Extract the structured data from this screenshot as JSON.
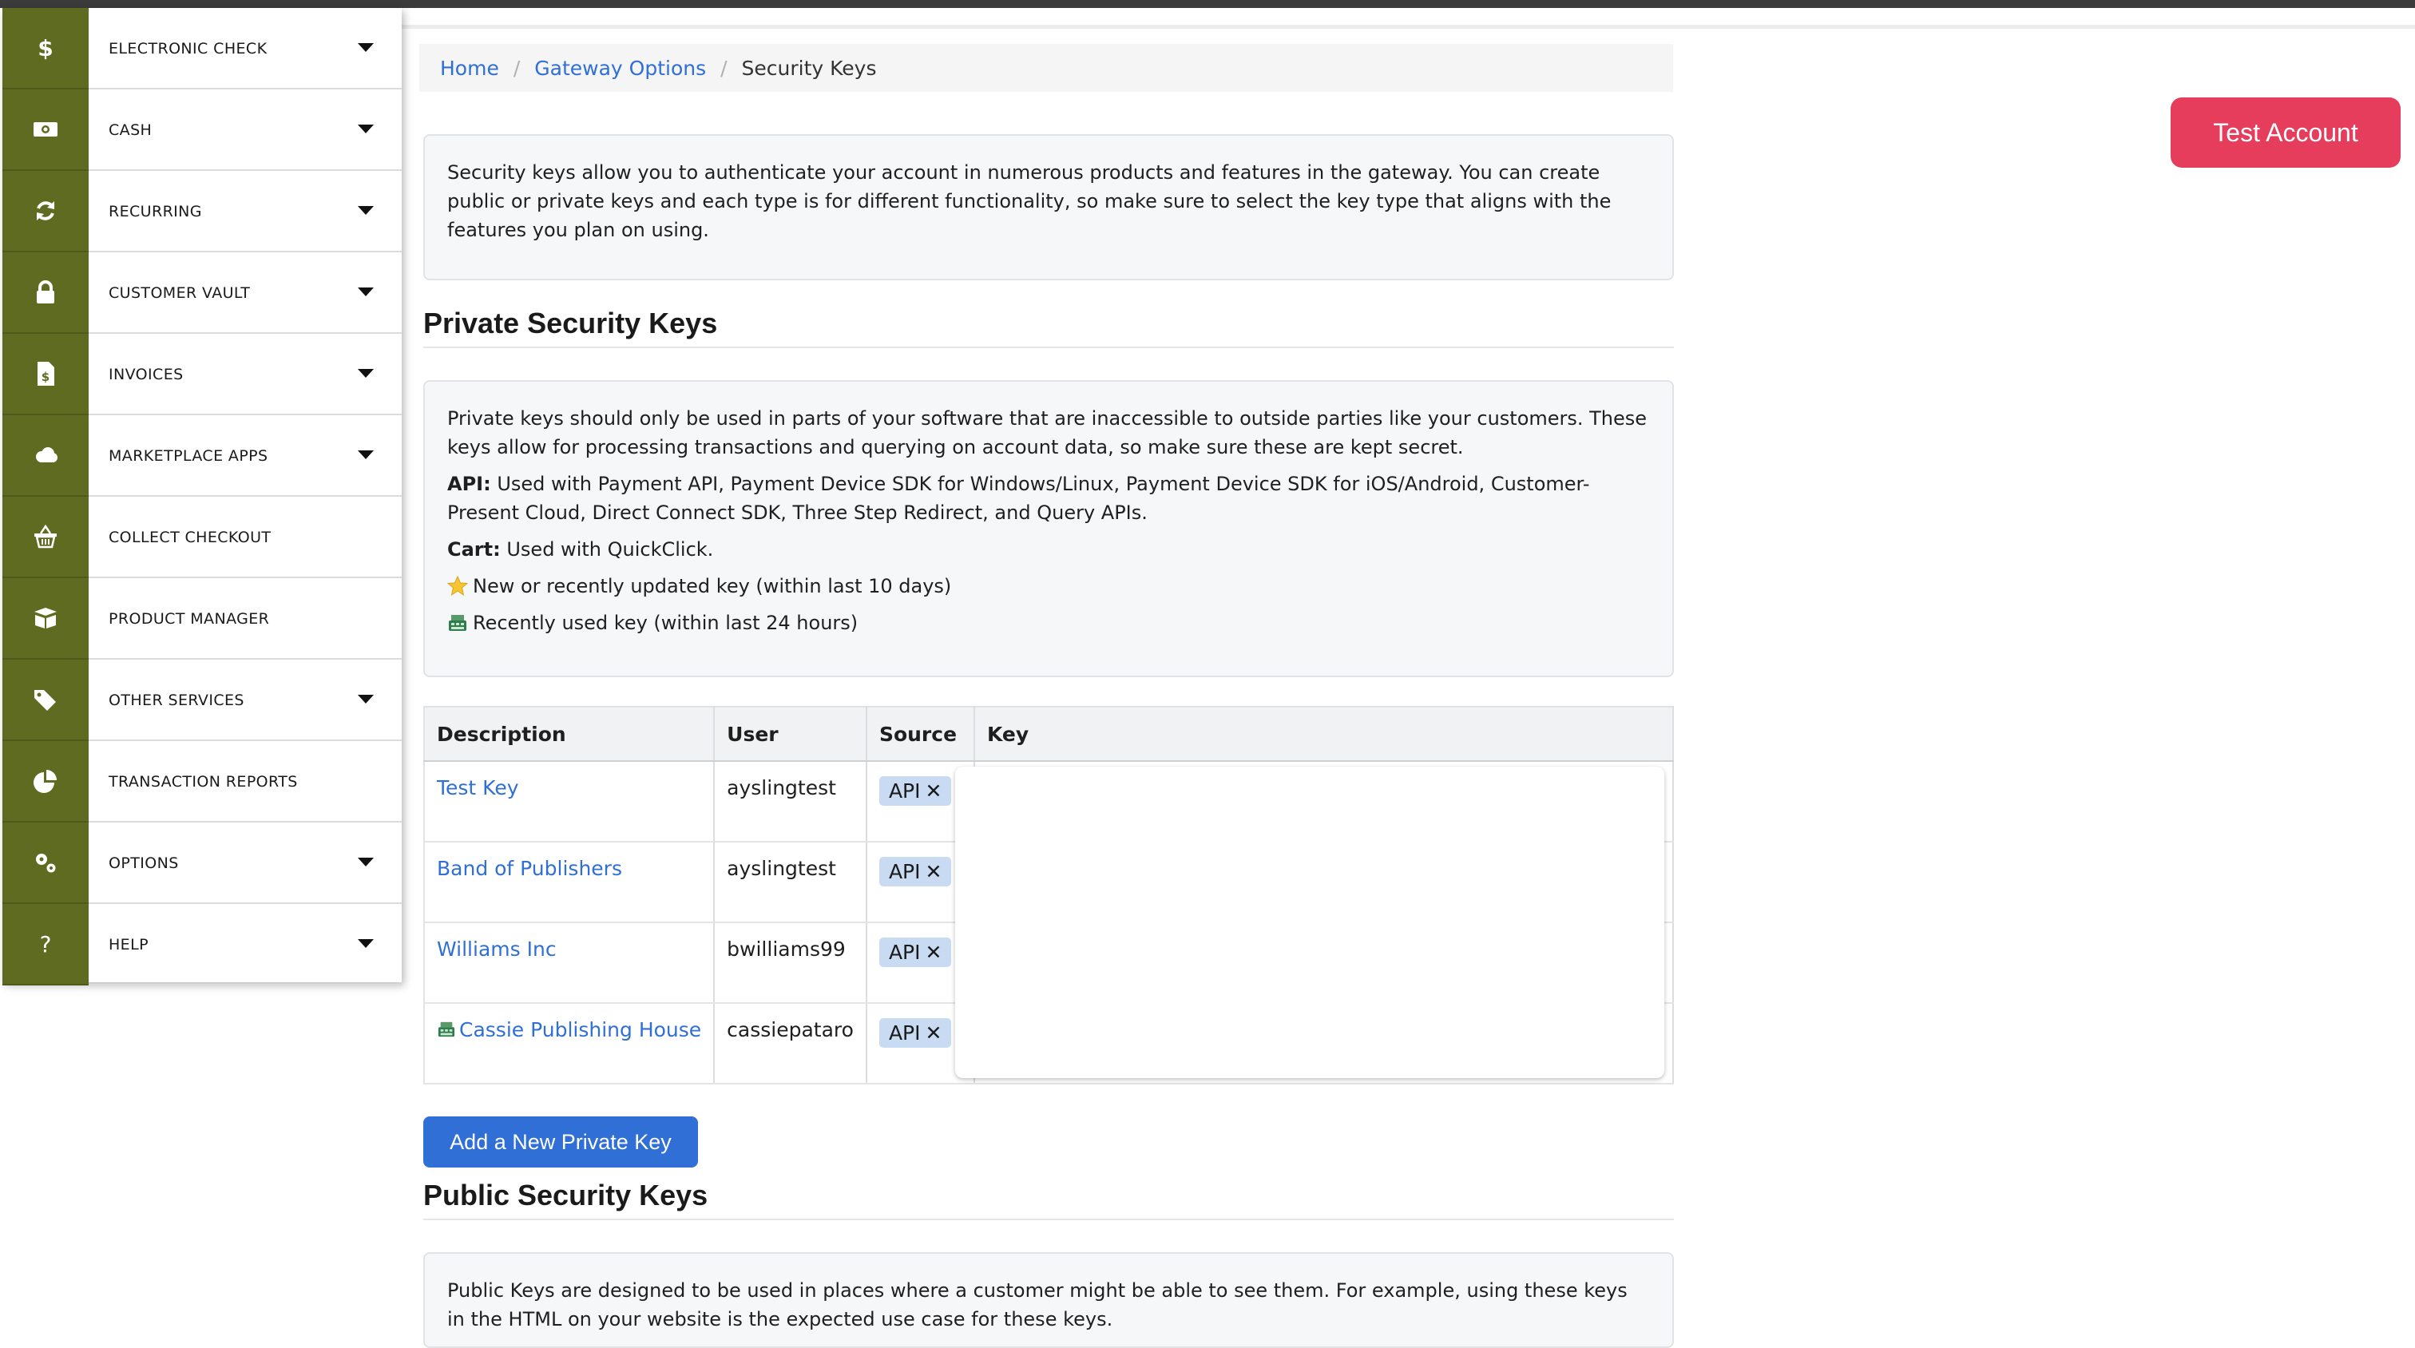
{
  "sidebar": {
    "items": [
      {
        "label": "ELECTRONIC CHECK",
        "icon": "dollar-icon",
        "has_caret": true
      },
      {
        "label": "CASH",
        "icon": "cash-icon",
        "has_caret": true
      },
      {
        "label": "RECURRING",
        "icon": "refresh-icon",
        "has_caret": true
      },
      {
        "label": "CUSTOMER VAULT",
        "icon": "lock-icon",
        "has_caret": true
      },
      {
        "label": "INVOICES",
        "icon": "invoice-icon",
        "has_caret": true
      },
      {
        "label": "MARKETPLACE APPS",
        "icon": "cloud-icon",
        "has_caret": true
      },
      {
        "label": "COLLECT CHECKOUT",
        "icon": "basket-icon",
        "has_caret": false
      },
      {
        "label": "PRODUCT MANAGER",
        "icon": "box-icon",
        "has_caret": false
      },
      {
        "label": "OTHER SERVICES",
        "icon": "tags-icon",
        "has_caret": true
      },
      {
        "label": "TRANSACTION REPORTS",
        "icon": "pie-chart-icon",
        "has_caret": false
      },
      {
        "label": "OPTIONS",
        "icon": "gears-icon",
        "has_caret": true
      },
      {
        "label": "HELP",
        "icon": "question-icon",
        "has_caret": true
      }
    ]
  },
  "breadcrumb": {
    "home": "Home",
    "gateway": "Gateway Options",
    "current": "Security Keys",
    "separator": "/"
  },
  "header": {
    "test_account": "Test Account"
  },
  "intro": {
    "text": "Security keys allow you to authenticate your account in numerous products and features in the gateway. You can create public or private keys and each type is for different functionality, so make sure to select the key type that aligns with the features you plan on using."
  },
  "private_section": {
    "title": "Private Security Keys",
    "description": "Private keys should only be used in parts of your software that are inaccessible to outside parties like your customers. These keys allow for processing transactions and querying on account data, so make sure these are kept secret.",
    "api_label": "API:",
    "api_text": "Used with Payment API, Payment Device SDK for Windows/Linux, Payment Device SDK for iOS/Android, Customer-Present Cloud, Direct Connect SDK, Three Step Redirect, and Query APIs.",
    "cart_label": "Cart:",
    "cart_text": "Used with QuickClick.",
    "legend_new": "New or recently updated key (within last 10 days)",
    "legend_used": "Recently used key (within last 24 hours)"
  },
  "table": {
    "headers": {
      "description": "Description",
      "user": "User",
      "source": "Source",
      "key": "Key"
    },
    "rows": [
      {
        "description": "Test Key",
        "user": "ayslingtest",
        "source": "API",
        "recent": false
      },
      {
        "description": "Band of Publishers",
        "user": "ayslingtest",
        "source": "API",
        "recent": false
      },
      {
        "description": "Williams Inc",
        "user": "bwilliams99",
        "source": "API",
        "recent": false
      },
      {
        "description": "Cassie Publishing House",
        "user": "cassiepataro",
        "source": "API",
        "recent": true
      }
    ],
    "remove_glyph": "✕"
  },
  "add_private_button": "Add a New Private Key",
  "public_section": {
    "title": "Public Security Keys",
    "description": "Public Keys are designed to be used in places where a customer might be able to see them. For example, using these keys in the HTML on your website is the expected use case for these keys."
  },
  "colors": {
    "sidebar_icon_bg": "#5e6b21",
    "link": "#2f6fd6",
    "primary_button": "#2f6fd6",
    "test_account": "#e53d5b",
    "badge": "#c8dbf3"
  }
}
